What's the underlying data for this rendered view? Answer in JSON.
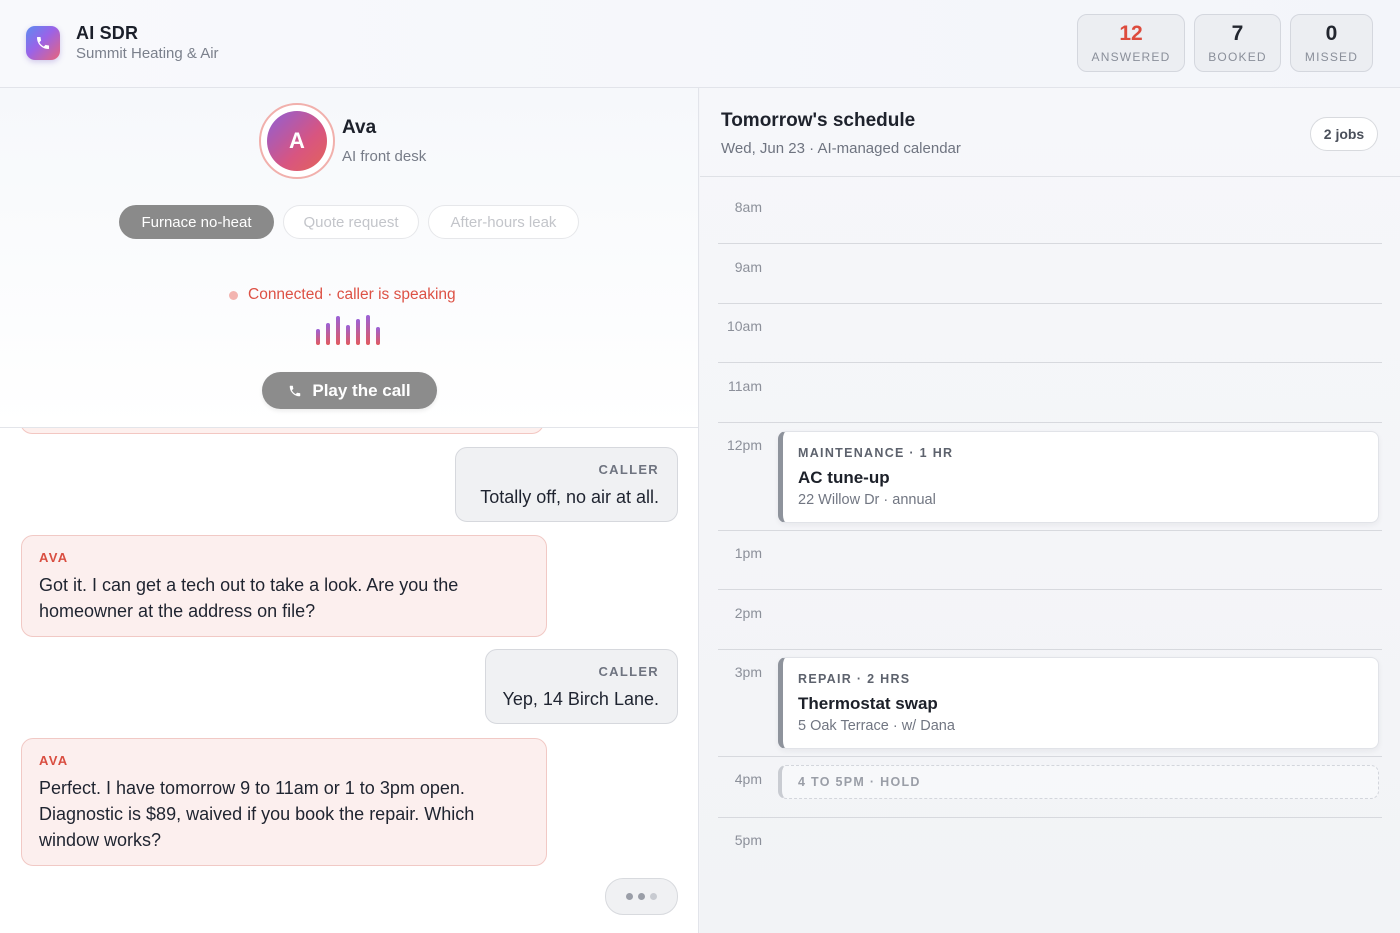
{
  "app": {
    "title": "AI SDR",
    "subtitle": "Summit Heating & Air",
    "logo_icon": "phone-icon",
    "accent": "#dd4b3d"
  },
  "stats": [
    {
      "value": "12",
      "label": "ANSWERED",
      "color": "#dd4b3d"
    },
    {
      "value": "7",
      "label": "BOOKED"
    },
    {
      "value": "0",
      "label": "MISSED"
    }
  ],
  "agent": {
    "initial": "A",
    "name": "Ava",
    "role": "AI front desk"
  },
  "scenarios": [
    {
      "label": "Furnace no-heat",
      "active": true
    },
    {
      "label": "Quote request",
      "active": false
    },
    {
      "label": "After-hours leak",
      "active": false
    }
  ],
  "call": {
    "status": "Connected · caller is speaking",
    "play_label": "Play the call"
  },
  "transcript": [
    {
      "speaker": "CALLER",
      "text": "Totally off, no air at all."
    },
    {
      "speaker": "AVA",
      "text": "Got it. I can get a tech out to take a look. Are you the homeowner at the address on file?"
    },
    {
      "speaker": "CALLER",
      "text": "Yep, 14 Birch Lane."
    },
    {
      "speaker": "AVA",
      "text": "Perfect. I have tomorrow 9 to 11am or 1 to 3pm open. Diagnostic is $89, waived if you book the repair. Which window works?"
    }
  ],
  "schedule": {
    "title": "Tomorrow's schedule",
    "subtitle": "Wed, Jun 23 · AI-managed calendar",
    "jobs_count": "2 jobs",
    "hours": [
      "8am",
      "9am",
      "10am",
      "11am",
      "12pm",
      "1pm",
      "2pm",
      "3pm",
      "4pm",
      "5pm"
    ],
    "events": [
      {
        "tag": "MAINTENANCE · 1 HR",
        "title": "AC tune-up",
        "detail": "22 Willow Dr · annual"
      },
      {
        "tag": "REPAIR · 2 HRS",
        "title": "Thermostat swap",
        "detail": "5 Oak Terrace · w/ Dana"
      }
    ],
    "hold": {
      "label": "4 TO 5PM · HOLD"
    }
  }
}
